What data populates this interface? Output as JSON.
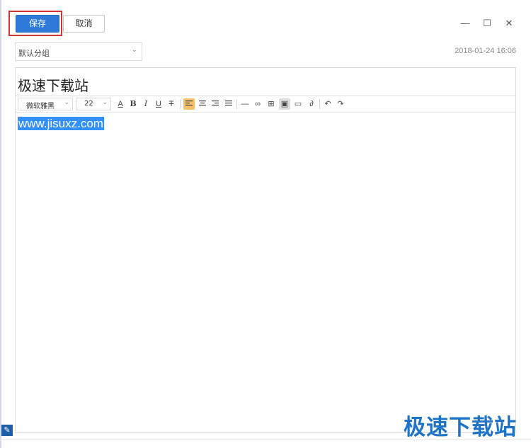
{
  "toolbar_top": {
    "save_label": "保存",
    "cancel_label": "取消"
  },
  "window_controls": {
    "minimize": "—",
    "maximize": "☐",
    "close": "✕"
  },
  "note": {
    "group": "默认分组",
    "date": "2018-01-24 16:06",
    "title": "极速下载站",
    "content": "www.jisuxz.com"
  },
  "format_bar": {
    "font_family": "微软雅黑",
    "font_size": "22",
    "buttons": [
      {
        "name": "font-color",
        "glyph": "A"
      },
      {
        "name": "bold",
        "glyph": "B"
      },
      {
        "name": "italic",
        "glyph": "I"
      },
      {
        "name": "underline",
        "glyph": "U"
      },
      {
        "name": "strikethrough",
        "glyph": "T"
      },
      {
        "name": "align-left",
        "glyph": "≡"
      },
      {
        "name": "align-center",
        "glyph": "≡"
      },
      {
        "name": "align-right",
        "glyph": "≡"
      },
      {
        "name": "justify",
        "glyph": "≡"
      },
      {
        "name": "horizontal-rule",
        "glyph": "—"
      },
      {
        "name": "link",
        "glyph": "∞"
      },
      {
        "name": "table",
        "glyph": "⊞"
      },
      {
        "name": "image-select",
        "glyph": "▣"
      },
      {
        "name": "image",
        "glyph": "▭"
      },
      {
        "name": "attachment",
        "glyph": "∂"
      },
      {
        "name": "undo",
        "glyph": "↶"
      },
      {
        "name": "redo",
        "glyph": "↷"
      }
    ]
  },
  "watermark": "极速下载站",
  "colors": {
    "accent": "#2f7ad8",
    "highlight_border": "#d0322f",
    "selection": "#3390ff",
    "active_button": "#f6c06a",
    "watermark": "#1e73c6"
  }
}
